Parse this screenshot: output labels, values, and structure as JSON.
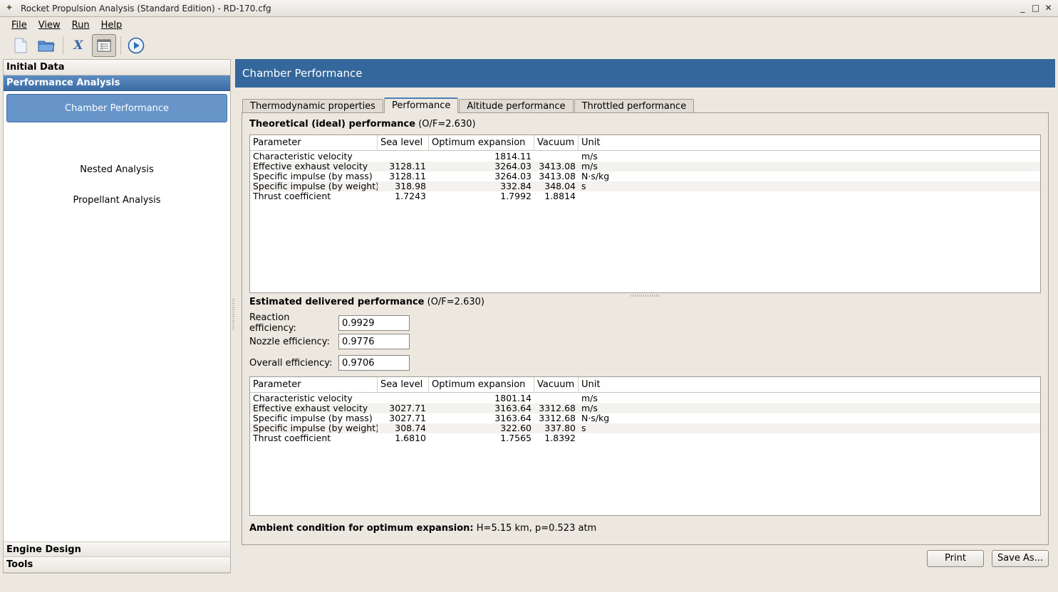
{
  "window": {
    "title": "Rocket Propulsion Analysis (Standard Edition) - RD-170.cfg",
    "controls": [
      "_",
      "□",
      "✕"
    ]
  },
  "menu": [
    {
      "label": "File"
    },
    {
      "label": "View"
    },
    {
      "label": "Run"
    },
    {
      "label": "Help"
    }
  ],
  "toolbar": {
    "icons": [
      "new-file-icon",
      "open-folder-icon",
      "formula-icon",
      "report-icon",
      "run-icon"
    ],
    "formula_glyph": "X"
  },
  "sidebar": {
    "sections": {
      "initial": "Initial Data",
      "performance": "Performance Analysis",
      "engine": "Engine Design",
      "tools": "Tools"
    },
    "items": [
      {
        "label": "Chamber Performance"
      },
      {
        "label": "Nested Analysis"
      },
      {
        "label": "Propellant Analysis"
      }
    ]
  },
  "main": {
    "banner": "Chamber Performance",
    "tabs": [
      {
        "label": "Thermodynamic properties"
      },
      {
        "label": "Performance"
      },
      {
        "label": "Altitude performance"
      },
      {
        "label": "Throttled performance"
      }
    ],
    "theoretical": {
      "title": "Theoretical (ideal) performance",
      "suffix": "(O/F=2.630)"
    },
    "delivered": {
      "title": "Estimated delivered performance",
      "suffix": "(O/F=2.630)"
    },
    "columns": [
      "Parameter",
      "Sea level",
      "Optimum expansion",
      "Vacuum",
      "Unit"
    ],
    "ideal_rows": [
      [
        "Characteristic velocity",
        "",
        "1814.11",
        "",
        "m/s"
      ],
      [
        "Effective exhaust velocity",
        "3128.11",
        "3264.03",
        "3413.08",
        "m/s"
      ],
      [
        "Specific impulse (by mass)",
        "3128.11",
        "3264.03",
        "3413.08",
        "N·s/kg"
      ],
      [
        "Specific impulse (by weight)",
        "318.98",
        "332.84",
        "348.04",
        "s"
      ],
      [
        "Thrust coefficient",
        "1.7243",
        "1.7992",
        "1.8814",
        ""
      ]
    ],
    "delivered_rows": [
      [
        "Characteristic velocity",
        "",
        "1801.14",
        "",
        "m/s"
      ],
      [
        "Effective exhaust velocity",
        "3027.71",
        "3163.64",
        "3312.68",
        "m/s"
      ],
      [
        "Specific impulse (by mass)",
        "3027.71",
        "3163.64",
        "3312.68",
        "N·s/kg"
      ],
      [
        "Specific impulse (by weight)",
        "308.74",
        "322.60",
        "337.80",
        "s"
      ],
      [
        "Thrust coefficient",
        "1.6810",
        "1.7565",
        "1.8392",
        ""
      ]
    ],
    "efficiency": {
      "reaction_label": "Reaction efficiency:",
      "reaction_value": "0.9929",
      "nozzle_label": "Nozzle efficiency:",
      "nozzle_value": "0.9776",
      "overall_label": "Overall efficiency:",
      "overall_value": "0.9706"
    },
    "ambient": {
      "label": "Ambient condition for optimum expansion:",
      "value": "H=5.15 km, p=0.523 atm"
    },
    "buttons": {
      "print": "Print",
      "save_as": "Save As..."
    }
  },
  "colors": {
    "banner": "#34679c",
    "selected_nav": "#6895c9",
    "active_section": "#3b6da6"
  }
}
